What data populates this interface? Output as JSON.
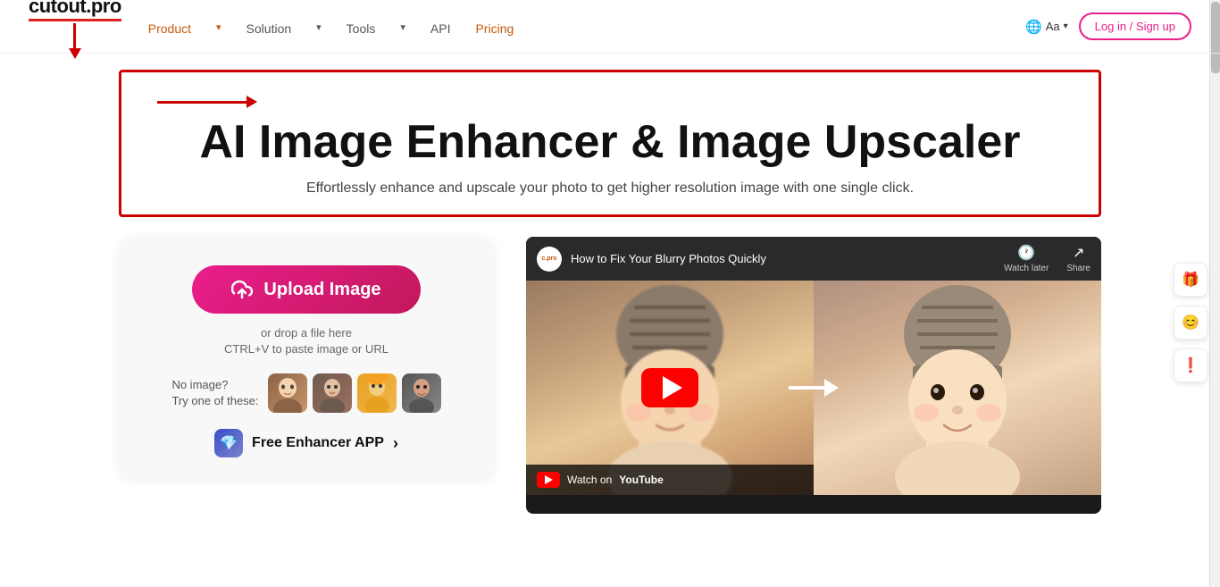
{
  "brand": {
    "name": "cutout.pro",
    "logo_underline_color": "#e02020"
  },
  "nav": {
    "links": [
      {
        "label": "Product",
        "has_dropdown": true,
        "color": "orange"
      },
      {
        "label": "Solution",
        "has_dropdown": true,
        "color": "orange"
      },
      {
        "label": "Tools",
        "has_dropdown": true,
        "color": "orange"
      },
      {
        "label": "API",
        "has_dropdown": false,
        "color": "normal"
      },
      {
        "label": "Pricing",
        "has_dropdown": false,
        "color": "orange"
      }
    ],
    "lang_icon": "🌐",
    "lang_label": "Aa",
    "login_label": "Log in / Sign up"
  },
  "hero": {
    "title": "AI Image Enhancer & Image Upscaler",
    "subtitle": "Effortlessly enhance and upscale your photo to get higher resolution image with one single click."
  },
  "upload": {
    "button_label": "Upload Image",
    "drop_text": "or drop a file here",
    "paste_text": "CTRL+V to paste image or URL"
  },
  "samples": {
    "label_line1": "No image?",
    "label_line2": "Try one of these:"
  },
  "free_app": {
    "label": "Free Enhancer APP",
    "chevron": "›"
  },
  "video": {
    "title": "How to Fix Your Blurry Photos Quickly",
    "watch_later_label": "Watch later",
    "share_label": "Share",
    "watch_on_label": "Watch on",
    "youtube_label": "YouTube"
  },
  "sidebar_icons": {
    "gift": "🎁",
    "face": "😊",
    "alert": "❗"
  }
}
